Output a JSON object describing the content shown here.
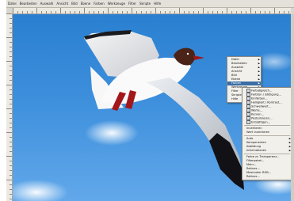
{
  "menubar": {
    "items": [
      "Datei",
      "Bearbeiten",
      "Auswahl",
      "Ansicht",
      "Bild",
      "Ebene",
      "Farben",
      "Werkzeuge",
      "Filter",
      "Skripte",
      "Hilfe"
    ]
  },
  "image": {
    "subject": "gull-in-flight"
  },
  "context_menu": {
    "items": [
      {
        "label": "Datei",
        "submenu": true
      },
      {
        "label": "Bearbeiten",
        "submenu": true
      },
      {
        "label": "Auswahl",
        "submenu": true
      },
      {
        "label": "Ansicht",
        "submenu": true
      },
      {
        "label": "Bild",
        "submenu": true
      },
      {
        "label": "Ebene",
        "submenu": true
      },
      {
        "label": "Farben",
        "submenu": true,
        "highlighted": true
      },
      {
        "label": "Werkzeuge",
        "submenu": true
      },
      {
        "label": "Filter",
        "submenu": true
      },
      {
        "label": "Skripte",
        "submenu": true
      },
      {
        "label": "Hilfe",
        "submenu": true
      }
    ]
  },
  "submenu": {
    "groups": [
      [
        "Farbabgleich...",
        "Farbton / Sättigung...",
        "Einfärben...",
        "Helligkeit / Kontrast...",
        "Schwellwert...",
        "Werte...",
        "Kurven...",
        "Posterisieren...",
        "Entsättigen..."
      ],
      [
        "Invertieren",
        "Wert invertieren"
      ],
      [
        "Auto",
        "Komponenten",
        "Abbildung",
        "Informationen"
      ],
      [
        "Farbe zu Transparenz...",
        "Filterpaket...",
        "Mehr...",
        "Retinex...",
        "Maximaler RGB...",
        "Retinex..."
      ]
    ],
    "group_submenus": [
      false,
      false,
      true,
      false
    ]
  }
}
